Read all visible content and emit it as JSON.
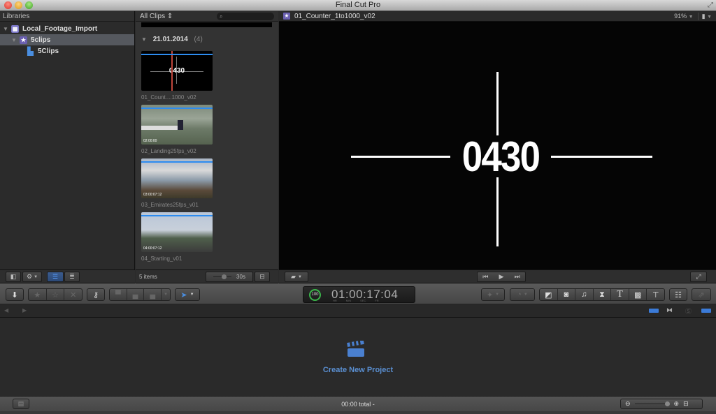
{
  "window": {
    "title": "Final Cut Pro"
  },
  "libraries": {
    "header": "Libraries",
    "items": [
      {
        "label": "Local_Footage_Import",
        "icon": "library-grid-icon",
        "level": 0,
        "expanded": true
      },
      {
        "label": "5clips",
        "icon": "event-star-icon",
        "level": 1,
        "expanded": true,
        "selected": true
      },
      {
        "label": "5Clips",
        "icon": "project-clip-icon",
        "level": 2
      }
    ]
  },
  "browser": {
    "filter": "All Clips ⇕",
    "search_placeholder": "🔍",
    "date_group": "21.01.2014",
    "date_count": "(4)",
    "clips": [
      {
        "name": "01_Count....1000_v02",
        "thumb_text": "0430"
      },
      {
        "name": "02_Landing25fps_v02",
        "timecode": "02:00:00"
      },
      {
        "name": "03_Emirates25fps_v01",
        "timecode": "03:00:07:12"
      },
      {
        "name": "04_Starting_v01",
        "timecode": "04:00:07:12"
      }
    ],
    "items_count": "5 items",
    "clip_duration": "30s"
  },
  "viewer": {
    "clip_title": "01_Counter_1to1000_v02",
    "zoom": "91%",
    "frame_number": "0430"
  },
  "toolbar": {
    "timecode": "01:00:17:04",
    "timecode_labels": [
      "HR",
      "MIN",
      "SEC",
      "FR"
    ],
    "progress_percent": "100"
  },
  "timeline": {
    "create_project_label": "Create New Project"
  },
  "statusbar": {
    "total": "00:00 total -"
  },
  "colors": {
    "accent_blue": "#2d8cf0",
    "project_link": "#5a8fd1",
    "progress_green": "#3bb34a"
  }
}
